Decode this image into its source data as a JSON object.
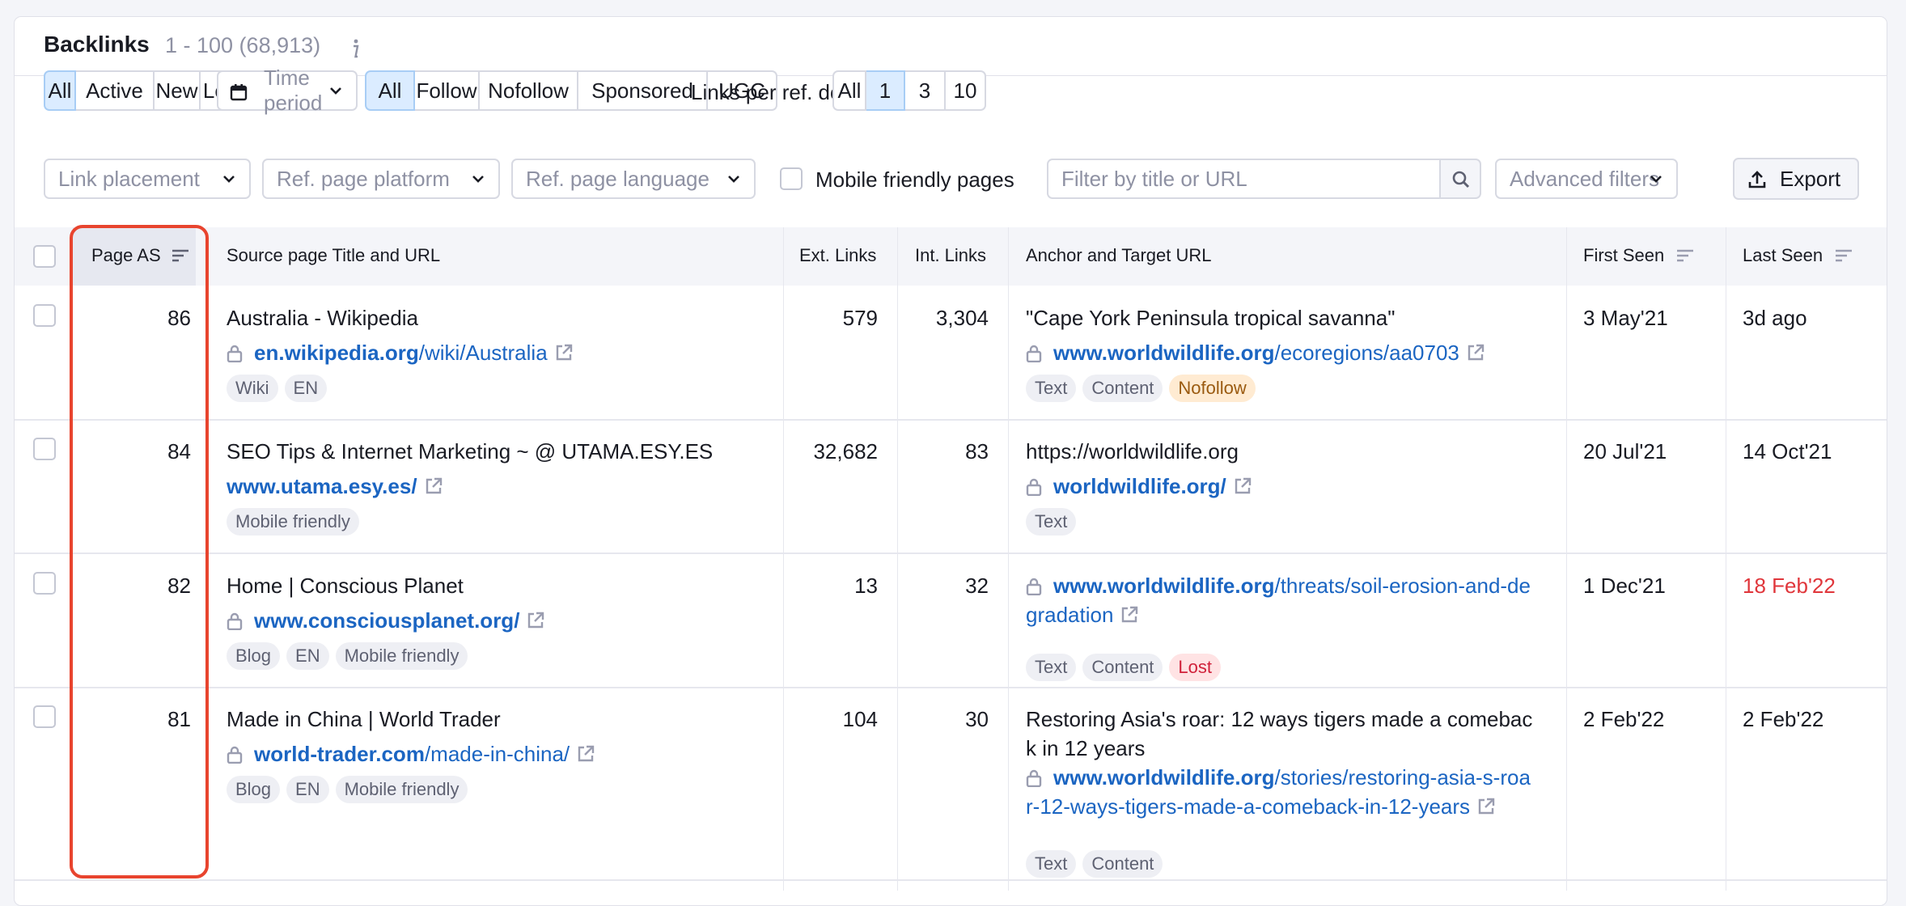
{
  "header": {
    "title": "Backlinks",
    "range": "1 - 100 (68,913)",
    "info": "i"
  },
  "filters": {
    "status": [
      "All",
      "Active",
      "New",
      "Lost"
    ],
    "status_active": "All",
    "time_period": "Time period",
    "link_type": [
      "All",
      "Follow",
      "Nofollow",
      "Sponsored",
      "UGC"
    ],
    "link_type_active": "All",
    "links_per_domain_label": "Links per ref. domain",
    "links_per_domain": [
      "All",
      "1",
      "3",
      "10"
    ],
    "links_per_domain_active": "1",
    "link_placement": "Link placement",
    "ref_page_platform": "Ref. page platform",
    "ref_page_language": "Ref. page language",
    "mobile_friendly_label": "Mobile friendly pages",
    "search_placeholder": "Filter by title or URL",
    "advanced_filters": "Advanced filters",
    "export": "Export"
  },
  "columns": {
    "page_as": "Page AS",
    "source": "Source page Title and URL",
    "ext_links": "Ext. Links",
    "int_links": "Int. Links",
    "anchor": "Anchor and Target URL",
    "first_seen": "First Seen",
    "last_seen": "Last Seen"
  },
  "rows": [
    {
      "page_as": "86",
      "title": "Australia - Wikipedia",
      "domain": "en.wikipedia.org",
      "path": "/wiki/Australia",
      "tags": [
        "Wiki",
        "EN"
      ],
      "ext_links": "579",
      "int_links": "3,304",
      "anchor": "\"Cape York Peninsula tropical savanna\"",
      "target_domain": "www.worldwildlife.org",
      "target_path": "/ecoregions/aa0703",
      "target_tags": [
        "Text",
        "Content",
        "Nofollow"
      ],
      "first_seen": "3 May'21",
      "last_seen": "3d ago"
    },
    {
      "page_as": "84",
      "title": "SEO Tips & Internet Marketing ~ @ UTAMA.ESY.ES",
      "domain": "www.utama.esy.es/",
      "path": "",
      "tags": [
        "Mobile friendly"
      ],
      "ext_links": "32,682",
      "int_links": "83",
      "anchor": "https://worldwildlife.org",
      "target_domain": "worldwildlife.org/",
      "target_path": "",
      "target_tags": [
        "Text"
      ],
      "first_seen": "20 Jul'21",
      "last_seen": "14 Oct'21"
    },
    {
      "page_as": "82",
      "title": "Home | Conscious Planet",
      "domain": "www.consciousplanet.org/",
      "path": "",
      "tags": [
        "Blog",
        "EN",
        "Mobile friendly"
      ],
      "ext_links": "13",
      "int_links": "32",
      "anchor": "",
      "target_domain": "www.worldwildlife.org",
      "target_path_line1": "/threats/soil-erosion-and-de",
      "target_path_line2": "gradation",
      "target_tags": [
        "Text",
        "Content",
        "Lost"
      ],
      "first_seen": "1 Dec'21",
      "last_seen": "18 Feb'22"
    },
    {
      "page_as": "81",
      "title": "Made in China | World Trader",
      "domain": "world-trader.com",
      "path": "/made-in-china/",
      "tags": [
        "Blog",
        "EN",
        "Mobile friendly"
      ],
      "ext_links": "104",
      "int_links": "30",
      "anchor_line1": "Restoring Asia's roar: 12 ways tigers made a comebac",
      "anchor_line2": "k in 12 years",
      "target_domain": "www.worldwildlife.org",
      "target_path_line1": "/stories/restoring-asia-s-roa",
      "target_path_line2": "r-12-ways-tigers-made-a-comeback-in-12-years",
      "target_tags": [
        "Text",
        "Content"
      ],
      "first_seen": "2 Feb'22",
      "last_seen": "2 Feb'22"
    }
  ],
  "colors": {
    "link": "#1b65c2",
    "active_bg": "#dbecff",
    "highlight": "#e8442e",
    "lost_date": "#e0363b"
  }
}
